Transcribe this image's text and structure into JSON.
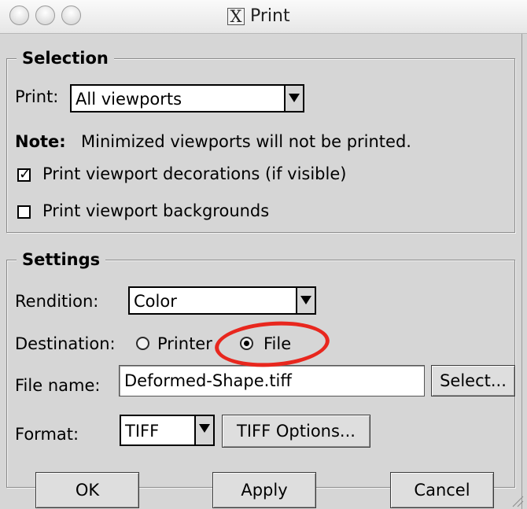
{
  "window": {
    "title": "Print"
  },
  "selection": {
    "title": "Selection",
    "print_label": "Print:",
    "print_value": "All viewports",
    "note_bold": "Note:",
    "note_text": "Minimized viewports will not be printed.",
    "decorations_label": "Print viewport decorations (if visible)",
    "decorations_checked": true,
    "backgrounds_label": "Print viewport backgrounds",
    "backgrounds_checked": false,
    "check_mark": "✓"
  },
  "settings": {
    "title": "Settings",
    "rendition_label": "Rendition:",
    "rendition_value": "Color",
    "destination_label": "Destination:",
    "destination_printer": "Printer",
    "destination_file": "File",
    "destination_selected": "File",
    "filename_label": "File name:",
    "filename_value": "Deformed-Shape.tiff",
    "select_button": "Select...",
    "format_label": "Format:",
    "format_value": "TIFF",
    "tiff_options_button": "TIFF Options..."
  },
  "buttons": {
    "ok": "OK",
    "apply": "Apply",
    "cancel": "Cancel"
  },
  "annotation": {
    "color": "#e8271e",
    "target": "File"
  },
  "icons": {
    "x_logo": "X"
  }
}
